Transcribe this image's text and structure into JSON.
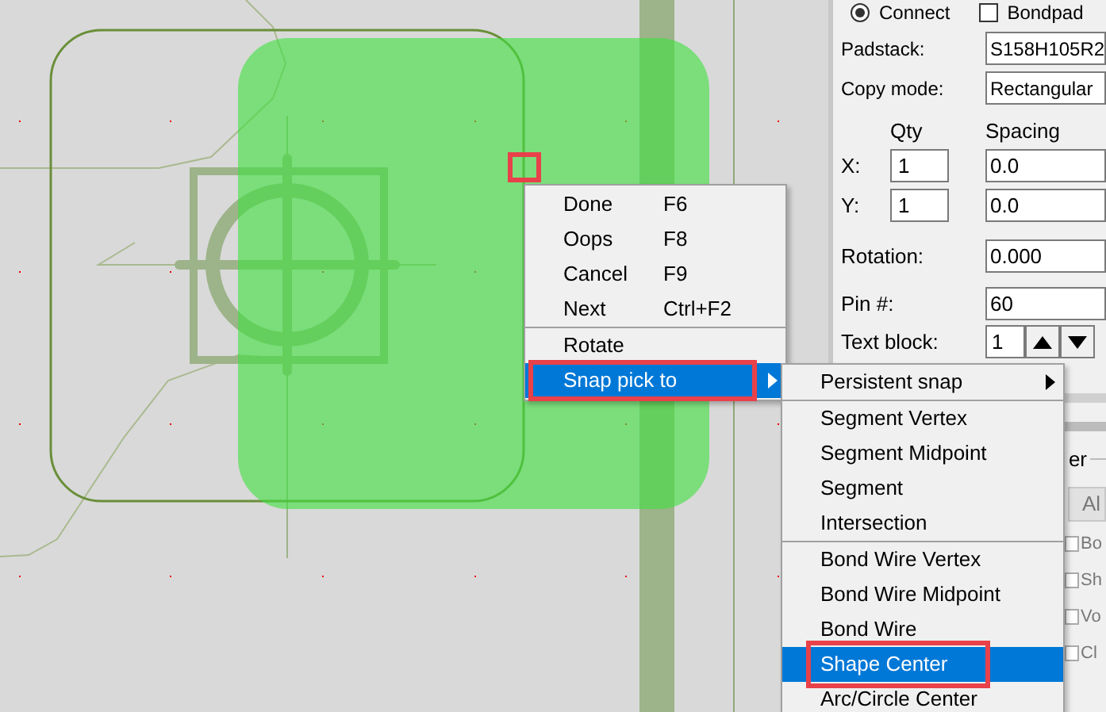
{
  "panel": {
    "top_options": [
      {
        "kind": "radio",
        "label": "Connect",
        "checked": true
      },
      {
        "kind": "checkbox",
        "label": "Bondpad",
        "checked": false
      }
    ],
    "fields": [
      {
        "label": "Padstack:",
        "value": "S158H105R2"
      },
      {
        "label": "Copy mode:",
        "value": "Rectangular"
      }
    ],
    "copy_grid": {
      "qty_header": "Qty",
      "spacing_header": "Spacing",
      "rows": [
        {
          "label": "X:",
          "qty": "1",
          "spacing": "0.0"
        },
        {
          "label": "Y:",
          "qty": "1",
          "spacing": "0.0"
        }
      ]
    },
    "rotation": {
      "label": "Rotation:",
      "value": "0.000"
    },
    "pin": {
      "label": "Pin #:",
      "value": "60"
    },
    "text_block": {
      "label": "Text block:",
      "value": "1"
    },
    "group_label": "er",
    "tab": "Al",
    "checkboxes": [
      {
        "label": "Bo",
        "checked": false
      },
      {
        "label": "Sh",
        "checked": false
      },
      {
        "label": "Vo",
        "checked": false
      },
      {
        "label": "Cl",
        "checked": false
      }
    ]
  },
  "context_menu": {
    "items": [
      {
        "label": "Done",
        "shortcut": "F6",
        "selected": false,
        "separator_before": false,
        "submenu": false
      },
      {
        "label": "Oops",
        "shortcut": "F8",
        "selected": false,
        "separator_before": false,
        "submenu": false
      },
      {
        "label": "Cancel",
        "shortcut": "F9",
        "selected": false,
        "separator_before": false,
        "submenu": false
      },
      {
        "label": "Next",
        "shortcut": "Ctrl+F2",
        "selected": false,
        "separator_before": false,
        "submenu": false
      },
      {
        "label": "Rotate",
        "selected": false,
        "separator_before": true,
        "submenu": false
      },
      {
        "label": "Snap pick to",
        "selected": true,
        "separator_before": false,
        "submenu": true
      }
    ]
  },
  "submenu": {
    "items": [
      {
        "label": "Persistent snap",
        "selected": false,
        "separator_before": false,
        "submenu": true
      },
      {
        "label": "Segment Vertex",
        "selected": false,
        "separator_before": true,
        "submenu": false
      },
      {
        "label": "Segment Midpoint",
        "selected": false,
        "separator_before": false,
        "submenu": false
      },
      {
        "label": "Segment",
        "selected": false,
        "separator_before": false,
        "submenu": false
      },
      {
        "label": "Intersection",
        "selected": false,
        "separator_before": false,
        "submenu": false
      },
      {
        "label": "Bond Wire Vertex",
        "selected": false,
        "separator_before": true,
        "submenu": false
      },
      {
        "label": "Bond Wire Midpoint",
        "selected": false,
        "separator_before": false,
        "submenu": false
      },
      {
        "label": "Bond Wire",
        "selected": false,
        "separator_before": false,
        "submenu": false
      },
      {
        "label": "Shape Center",
        "selected": true,
        "separator_before": false,
        "submenu": false
      },
      {
        "label": "Arc/Circle Center",
        "selected": false,
        "separator_before": false,
        "submenu": false
      }
    ]
  }
}
